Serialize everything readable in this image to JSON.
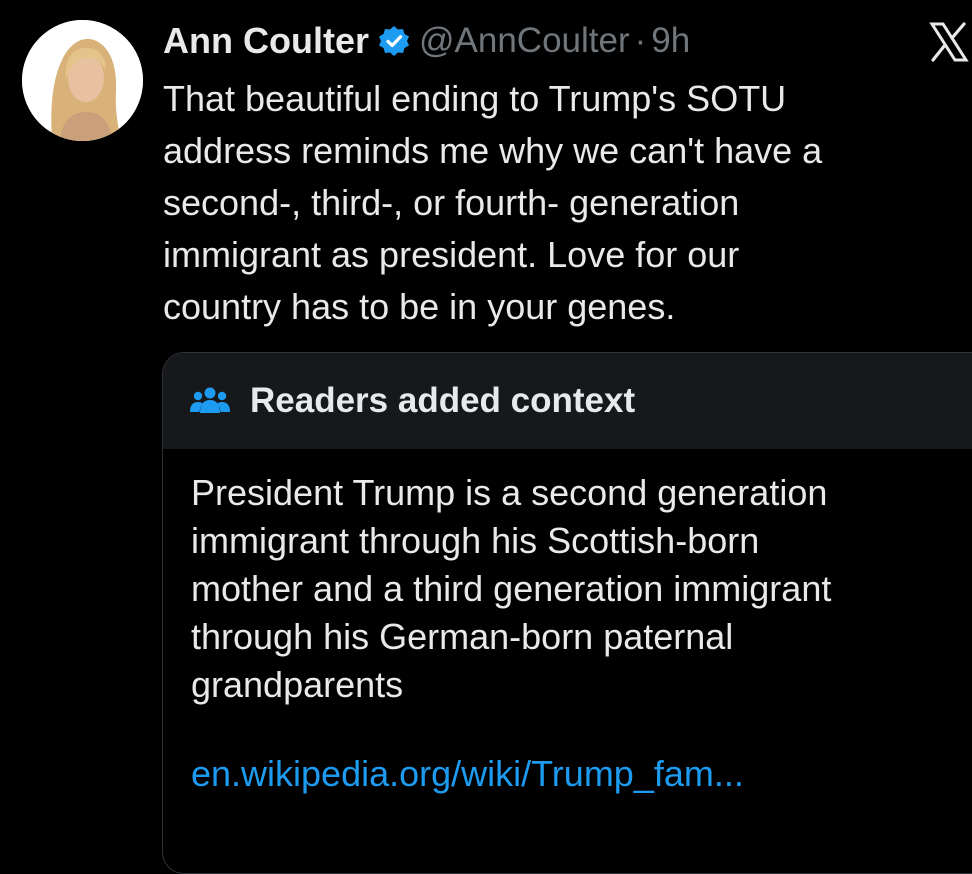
{
  "tweet": {
    "display_name": "Ann Coulter",
    "verified_icon": "verified-badge-icon",
    "handle": "@AnnCoulter",
    "separator": "·",
    "time": "9h",
    "platform_icon": "x-logo-icon",
    "avatar": "avatar",
    "text_lines": [
      "That beautiful ending to Trump's SOTU",
      "address reminds me why we can't have a",
      "second-, third-, or fourth- generation",
      "immigrant as president.  Love for our",
      "country has to be in your genes."
    ]
  },
  "community_note": {
    "icon": "people-icon",
    "title": "Readers added context",
    "body_lines": [
      "President Trump is a second generation",
      "immigrant through his Scottish-born",
      "mother and a third generation immigrant",
      "through his German-born paternal",
      "grandparents"
    ],
    "link": "en.wikipedia.org/wiki/Trump_fam..."
  },
  "colors": {
    "background": "#000000",
    "text_primary": "#e7e9ea",
    "text_secondary": "#71767b",
    "accent": "#1d9bf0",
    "note_header_bg": "#16181c",
    "border": "#2f3336"
  }
}
